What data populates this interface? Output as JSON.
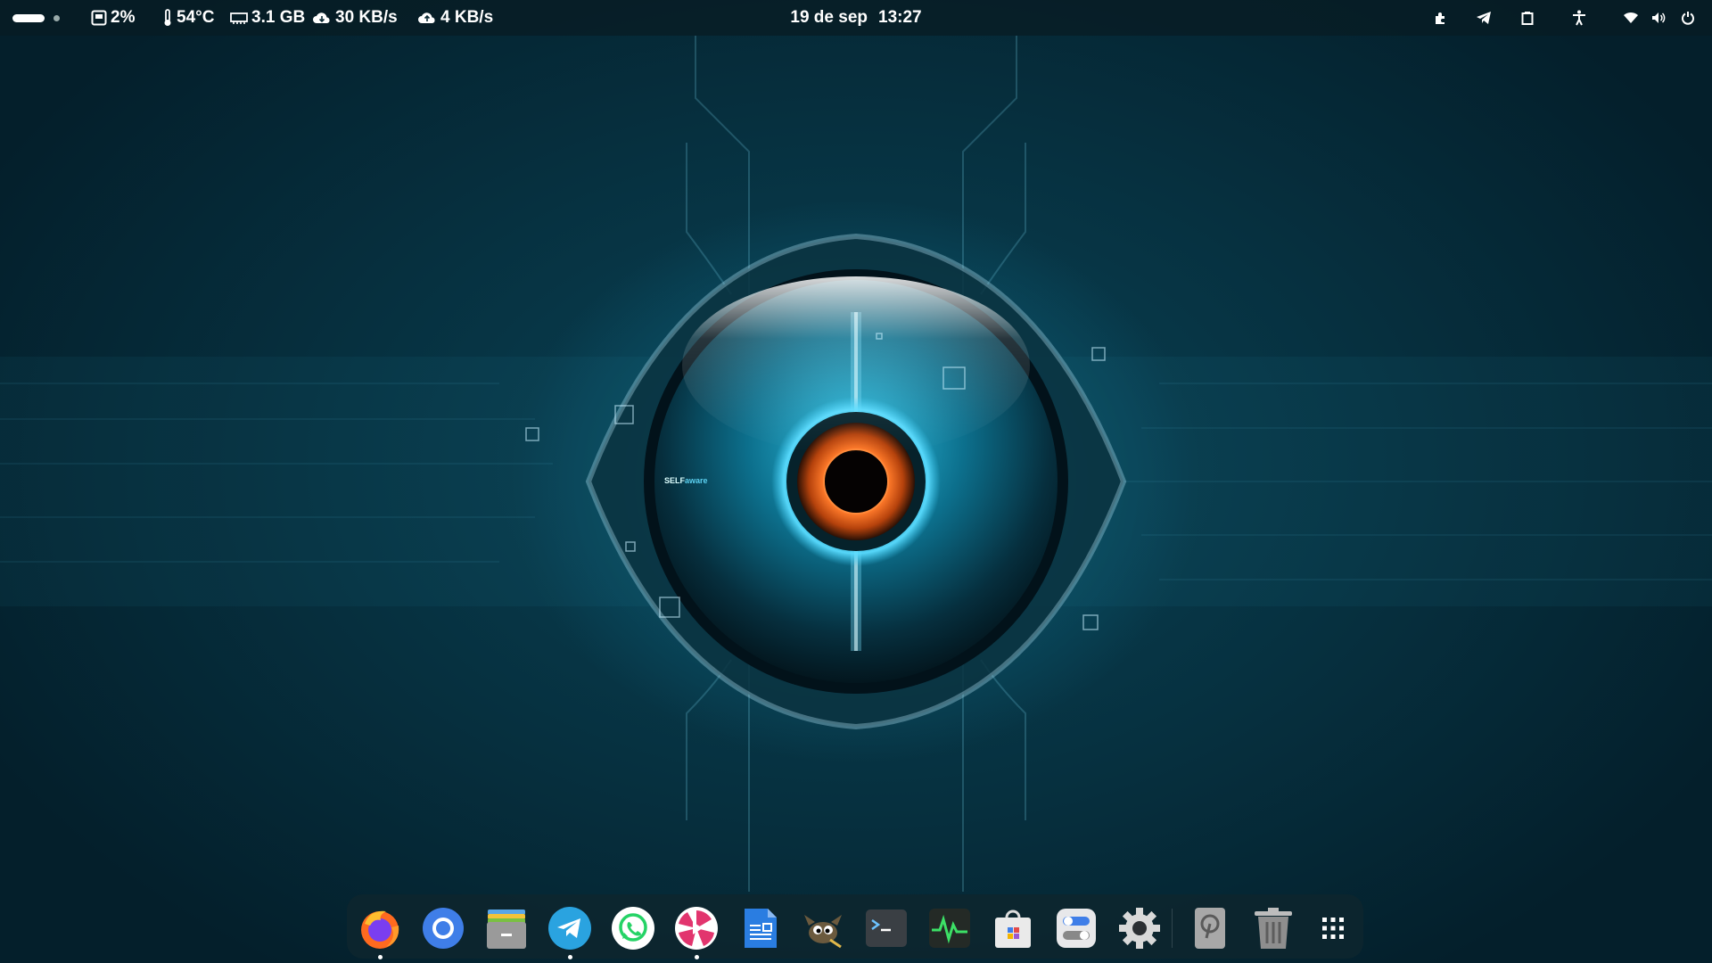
{
  "topbar": {
    "disk_usage": "2%",
    "temperature": "54°C",
    "memory": "3.1 GB",
    "download_speed": "30 KB/s",
    "upload_speed": "4 KB/s",
    "date": "19 de sep",
    "time": "13:27"
  },
  "tray_icons": [
    "extensions-icon",
    "telegram-icon",
    "clipboard-icon",
    "accessibility-icon",
    "wifi-icon",
    "volume-icon",
    "power-icon"
  ],
  "wallpaper": {
    "brand_text": "SELFaware",
    "colors": {
      "bg": "#06303f",
      "glow": "#1ea9c9",
      "iris": "#e0621d"
    }
  },
  "dock": {
    "apps": [
      {
        "name": "Firefox",
        "icon": "firefox-icon",
        "running": true
      },
      {
        "name": "Chromium",
        "icon": "chromium-icon",
        "running": false
      },
      {
        "name": "Files",
        "icon": "files-icon",
        "running": false
      },
      {
        "name": "Telegram",
        "icon": "telegram-icon",
        "running": true
      },
      {
        "name": "WhatsApp",
        "icon": "whatsapp-icon",
        "running": false
      },
      {
        "name": "Media Player",
        "icon": "media-player-icon",
        "running": true
      },
      {
        "name": "Text Editor",
        "icon": "document-editor-icon",
        "running": false
      },
      {
        "name": "GIMP",
        "icon": "gimp-icon",
        "running": false
      },
      {
        "name": "Terminal",
        "icon": "terminal-icon",
        "running": false
      },
      {
        "name": "System Monitor",
        "icon": "system-monitor-icon",
        "running": false
      },
      {
        "name": "Software Store",
        "icon": "software-store-icon",
        "running": false
      },
      {
        "name": "Tweaks",
        "icon": "tweaks-icon",
        "running": false
      },
      {
        "name": "Settings",
        "icon": "settings-gear-icon",
        "running": false
      },
      {
        "name": "Disks",
        "icon": "disk-drive-icon",
        "running": false
      },
      {
        "name": "Trash",
        "icon": "trash-icon",
        "running": false
      },
      {
        "name": "Show Applications",
        "icon": "app-grid-icon",
        "running": false
      }
    ]
  }
}
